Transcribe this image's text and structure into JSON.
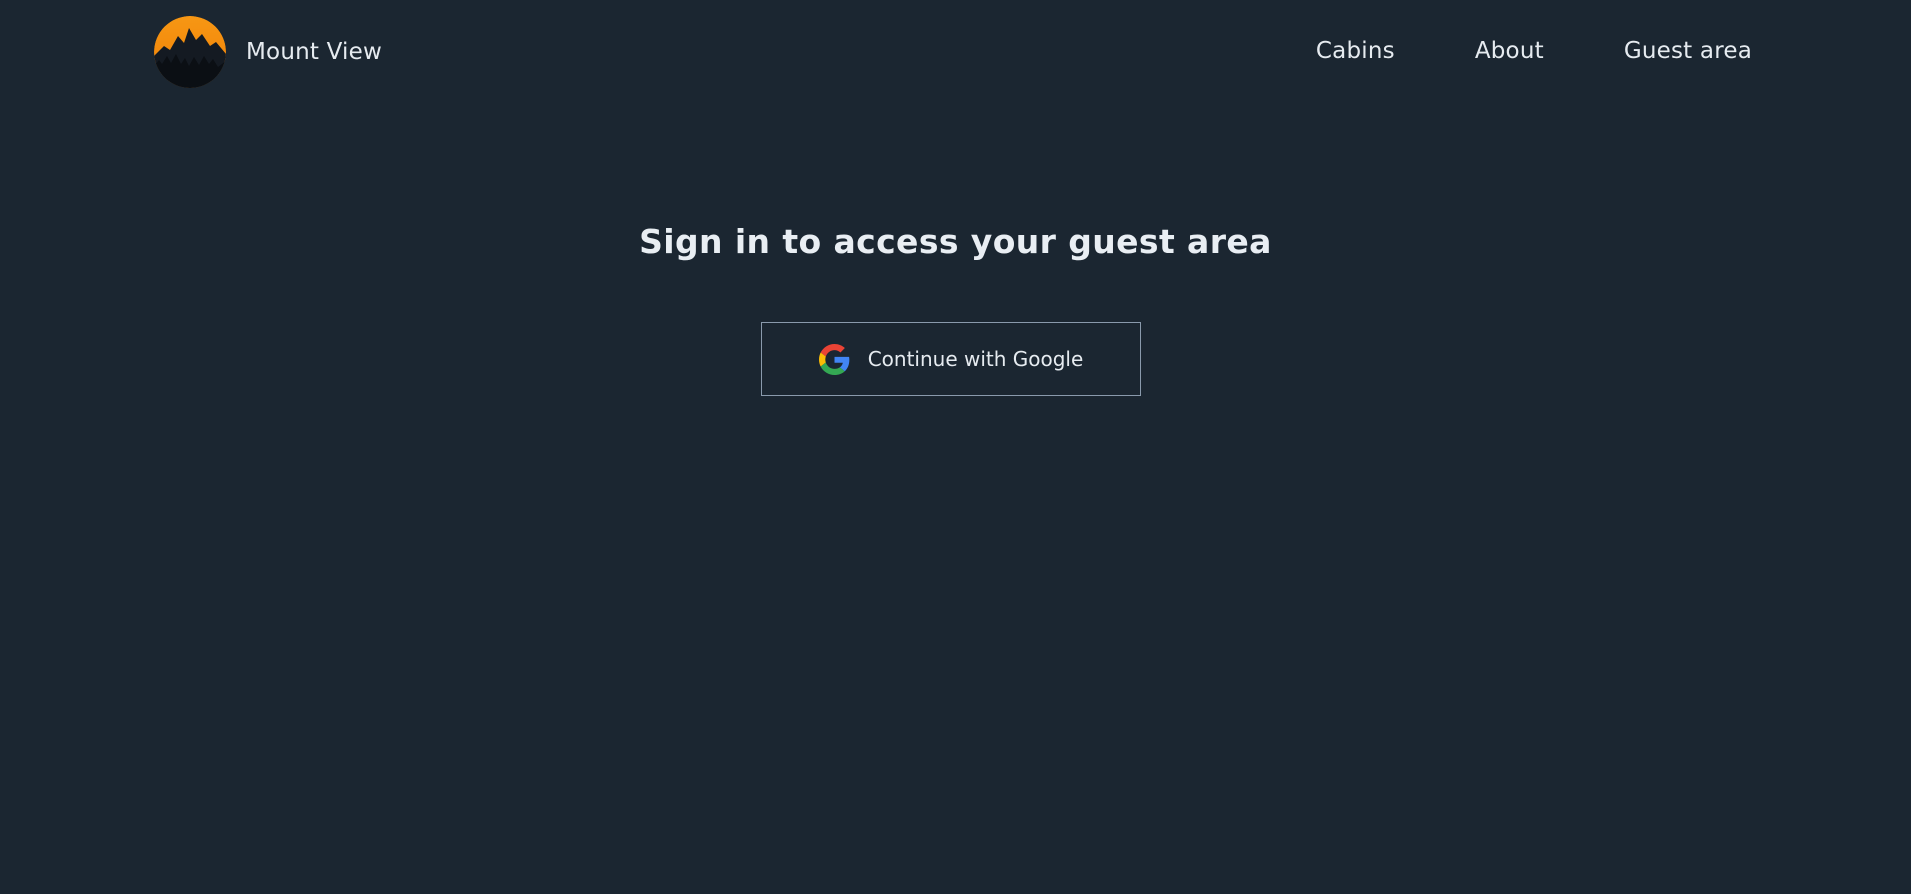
{
  "header": {
    "brand_name": "Mount View",
    "nav": [
      {
        "label": "Cabins"
      },
      {
        "label": "About"
      },
      {
        "label": "Guest area"
      }
    ]
  },
  "main": {
    "title": "Sign in to access your guest area",
    "google_button_label": "Continue with Google"
  },
  "icons": {
    "logo": "mountain-sunset-logo",
    "google": "google-icon"
  },
  "colors": {
    "background": "#1b2631",
    "text": "#e6ebf0",
    "button_border": "#8a9aac",
    "logo_orange": "#f58a07"
  }
}
